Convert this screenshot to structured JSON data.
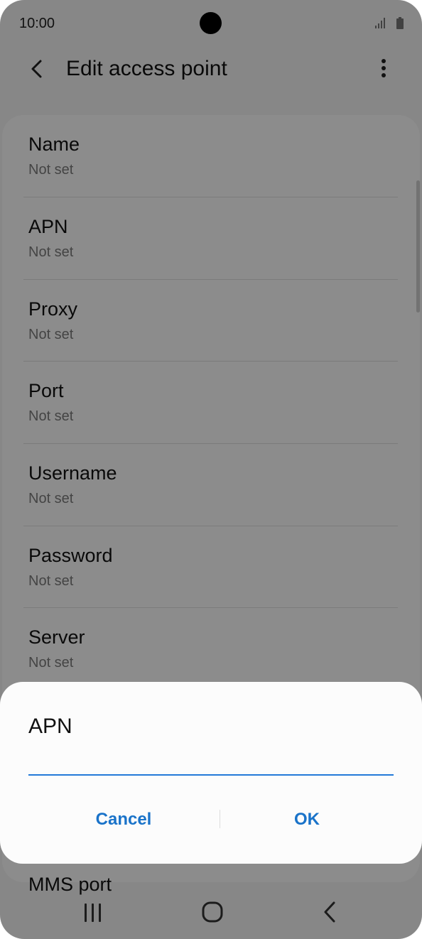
{
  "status_bar": {
    "time": "10:00"
  },
  "app_bar": {
    "title": "Edit access point"
  },
  "settings": [
    {
      "label": "Name",
      "value": "Not set"
    },
    {
      "label": "APN",
      "value": "Not set"
    },
    {
      "label": "Proxy",
      "value": "Not set"
    },
    {
      "label": "Port",
      "value": "Not set"
    },
    {
      "label": "Username",
      "value": "Not set"
    },
    {
      "label": "Password",
      "value": "Not set"
    },
    {
      "label": "Server",
      "value": "Not set"
    },
    {
      "label": "MMS port",
      "value": ""
    }
  ],
  "dialog": {
    "title": "APN",
    "input_value": "",
    "cancel_label": "Cancel",
    "ok_label": "OK"
  },
  "colors": {
    "accent": "#1a73c9",
    "input_underline": "#2379d8"
  }
}
